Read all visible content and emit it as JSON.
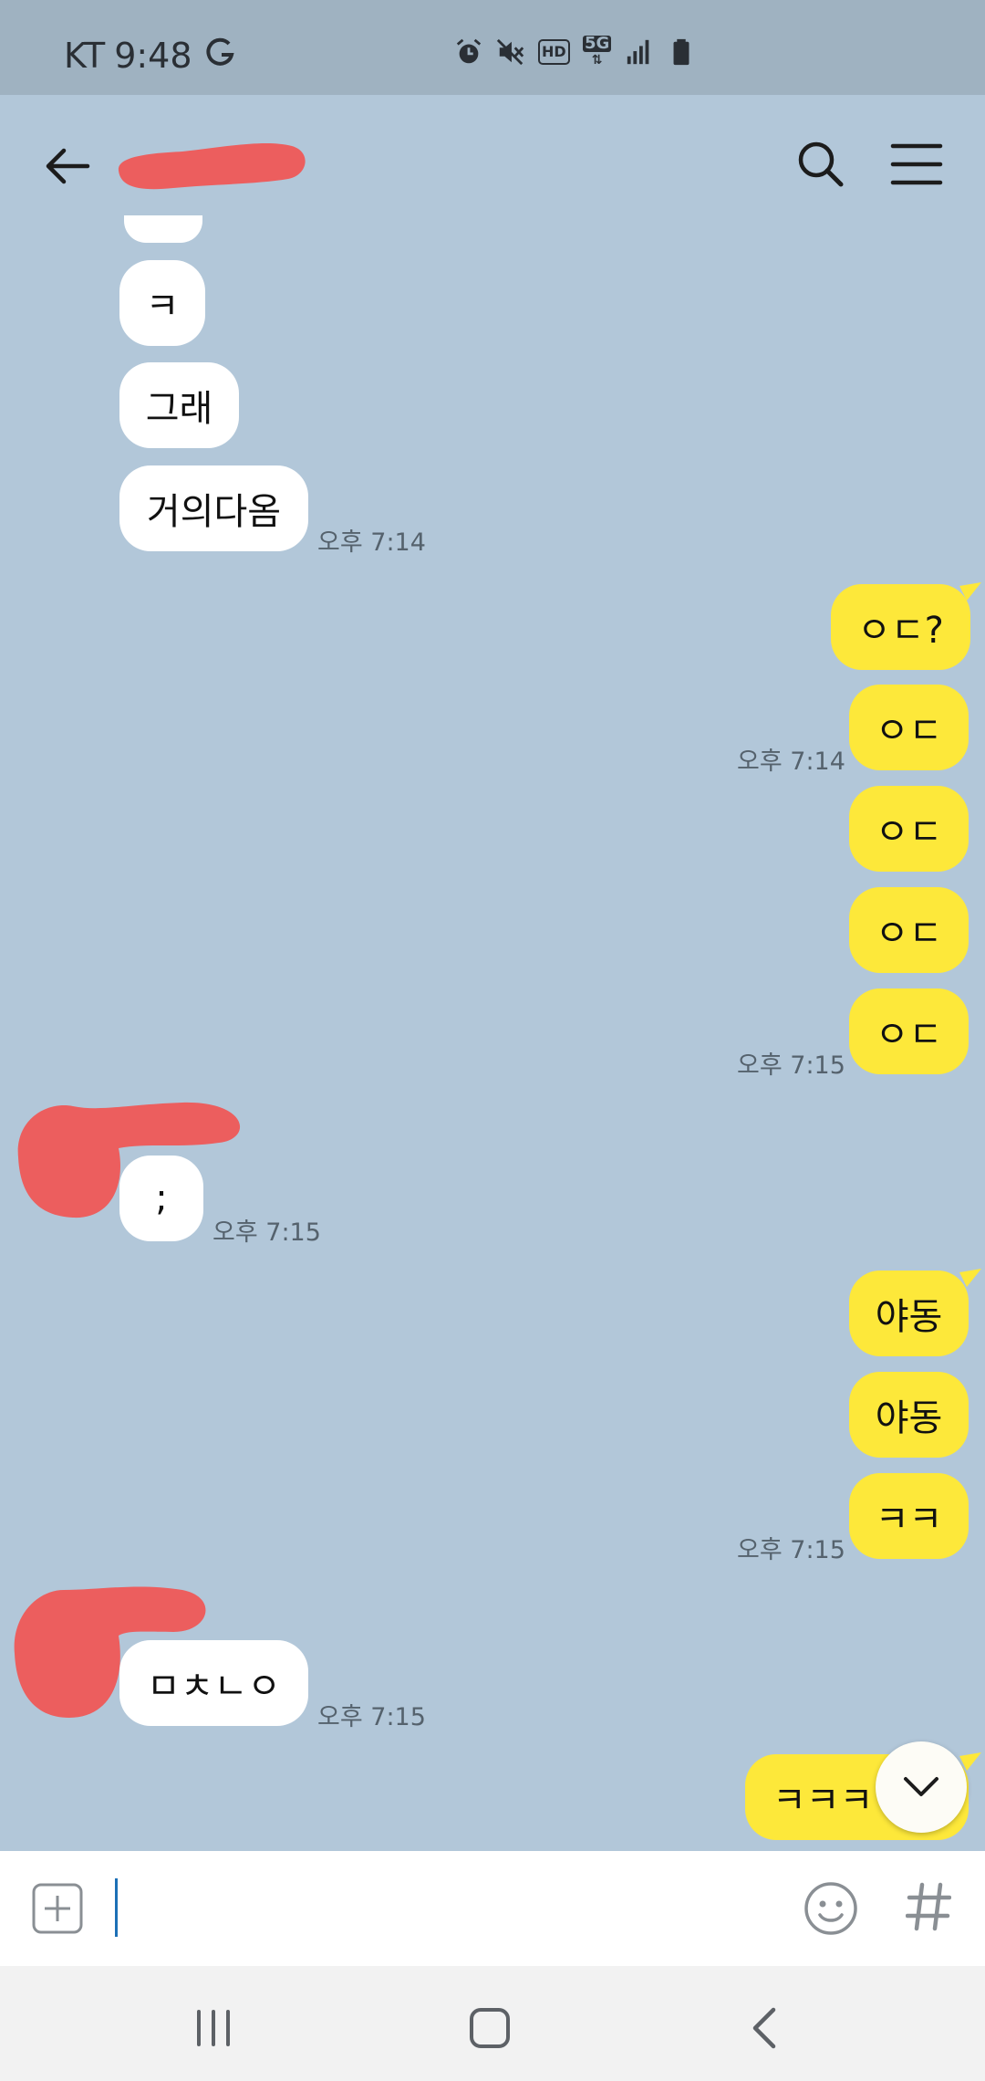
{
  "status_bar": {
    "carrier": "KT",
    "time": "9:48",
    "icons": [
      "g-icon",
      "alarm-icon",
      "mute-icon",
      "hd-icon",
      "5g-icon",
      "signal-icon",
      "battery-icon"
    ],
    "hd_label": "HD",
    "fiveg_label": "5G"
  },
  "header": {
    "icons": [
      "back-arrow-icon",
      "search-icon",
      "menu-icon"
    ]
  },
  "messages": {
    "in1": {
      "text": "ㅋ"
    },
    "in2": {
      "text": "그래"
    },
    "in3": {
      "text": "거의다옴",
      "time": "오후 7:14"
    },
    "out1": {
      "text": "ㅇㄷ?"
    },
    "out2": {
      "text": "ㅇㄷ",
      "time": "오후 7:14"
    },
    "out3": {
      "text": "ㅇㄷ"
    },
    "out4": {
      "text": "ㅇㄷ"
    },
    "out5": {
      "text": "ㅇㄷ",
      "time": "오후 7:15"
    },
    "in4": {
      "text": ";",
      "time": "오후 7:15"
    },
    "out6": {
      "text": "야동"
    },
    "out7": {
      "text": "야동"
    },
    "out8": {
      "text": "ㅋㅋ",
      "time": "오후 7:15"
    },
    "in5": {
      "text": "ㅁㅊㄴㅇ",
      "time": "오후 7:15"
    },
    "out9": {
      "text": "ㅋㅋㅋㅋㅋ"
    }
  },
  "input": {
    "value": "",
    "placeholder": ""
  },
  "colors": {
    "background": "#b2c7d9",
    "incoming_bubble": "#ffffff",
    "outgoing_bubble": "#fde83a",
    "redaction": "#ec5e5e"
  }
}
